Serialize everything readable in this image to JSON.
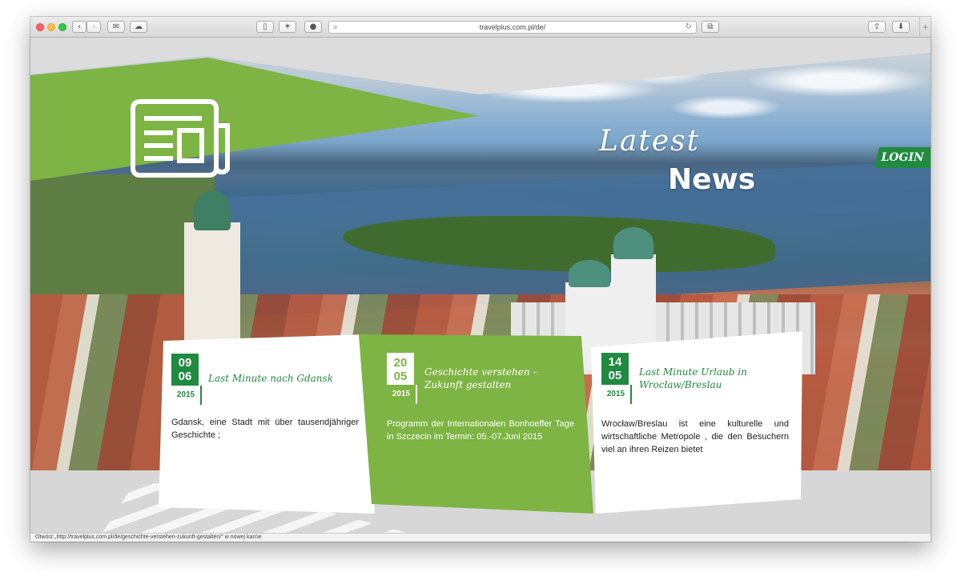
{
  "browser": {
    "url": "travelplus.com.pl/de/",
    "status_text": "Otwórz „http://travelplus.com.pl/de/geschichte-verstehen-zukunft-gestalten/\" w nowej karcie",
    "toolbar_icons": [
      "back-icon",
      "forward-icon",
      "mail-icon",
      "cloud-icon",
      "sidebar-icon",
      "reader-icon",
      "adblock-icon",
      "tabs-icon",
      "share-icon",
      "download-icon",
      "new-tab-icon"
    ]
  },
  "header": {
    "title_line1": "Latest",
    "title_line2": "News",
    "login_label": "LOGIN",
    "news_icon": "newspaper-icon"
  },
  "news": [
    {
      "day": "09",
      "month": "06",
      "year": "2015",
      "title": "Last Minute nach Gdansk",
      "text": "Gdansk, eine Stadt mit über tausendjähriger Geschichte ;"
    },
    {
      "day": "20",
      "month": "05",
      "year": "2015",
      "title": "Geschichte verstehen – Zukunft gestalten",
      "text": "Programm der Internationalen Bonhoeffer Tage in Szczecin im Termin: 05.-07.Juni 2015"
    },
    {
      "day": "14",
      "month": "05",
      "year": "2015",
      "title": "Last Minute Urlaub in Wrocław/Breslau",
      "text": "Wrocław/Breslau ist eine kulturelle und wirtschaftliche Metropole , die den Besuchern viel an ihren Reizen bietet"
    }
  ],
  "colors": {
    "brand_green": "#7db443",
    "dark_green": "#1f8b3f"
  }
}
